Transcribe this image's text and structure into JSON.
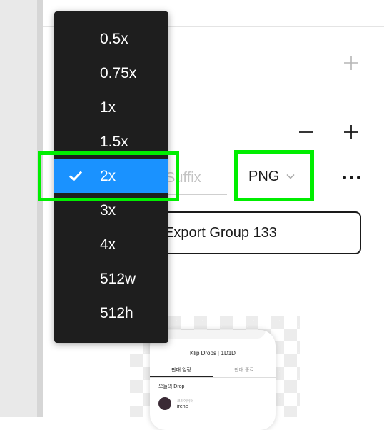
{
  "scale_dropdown": {
    "items": [
      {
        "label": "0.5x"
      },
      {
        "label": "0.75x"
      },
      {
        "label": "1x"
      },
      {
        "label": "1.5x"
      },
      {
        "label": "2x",
        "selected": true
      },
      {
        "label": "3x"
      },
      {
        "label": "4x"
      },
      {
        "label": "512w"
      },
      {
        "label": "512h"
      }
    ]
  },
  "export_row": {
    "suffix_placeholder": "Suffix",
    "format_value": "PNG"
  },
  "export_button": {
    "label": "Export Group 133"
  },
  "preview": {
    "app_title": "Klip Drops",
    "app_title_sep": "|",
    "app_title_code": "1D1D",
    "tab_active": "판매 일정",
    "tab_inactive": "판매 종료",
    "section_title": "오늘의 Drop",
    "owner_small": "크리에이터",
    "owner_name": "irene"
  },
  "colors": {
    "highlight": "#00ee00",
    "selected_item": "#1a92ff",
    "dropdown_bg": "#1e1e1e"
  },
  "icons": [
    "plus-icon",
    "minus-icon",
    "chevron-down-icon",
    "more-icon",
    "checkmark-icon"
  ]
}
